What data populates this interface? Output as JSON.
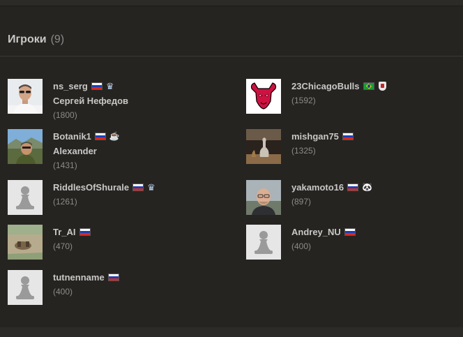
{
  "section": {
    "title": "Игроки",
    "count": "(9)"
  },
  "players": [
    {
      "username": "ns_serg",
      "flag": "ru",
      "badge": "crown",
      "realname": "Сергей Нефедов",
      "rating": "(1800)",
      "avatar": "photo-man"
    },
    {
      "username": "23ChicagoBulls",
      "flag": "br",
      "badge": "shield",
      "realname": "",
      "rating": "(1592)",
      "avatar": "bulls-logo"
    },
    {
      "username": "Botanik1",
      "flag": "ru",
      "badge": "coffee",
      "realname": "Alexander",
      "rating": "(1431)",
      "avatar": "photo-outdoor"
    },
    {
      "username": "mishgan75",
      "flag": "ru",
      "badge": "",
      "realname": "",
      "rating": "(1325)",
      "avatar": "photo-chess"
    },
    {
      "username": "RiddlesOfShurale",
      "flag": "ru",
      "badge": "crown",
      "realname": "",
      "rating": "(1261)",
      "avatar": "pawn"
    },
    {
      "username": "yakamoto16",
      "flag": "ru",
      "badge": "panda",
      "realname": "",
      "rating": "(897)",
      "avatar": "photo-bald"
    },
    {
      "username": "Tr_AI",
      "flag": "ru",
      "badge": "",
      "realname": "",
      "rating": "(470)",
      "avatar": "photo-field"
    },
    {
      "username": "Andrey_NU",
      "flag": "ru",
      "badge": "",
      "realname": "",
      "rating": "(400)",
      "avatar": "pawn"
    },
    {
      "username": "tutnenname",
      "flag": "ru",
      "badge": "",
      "realname": "",
      "rating": "(400)",
      "avatar": "pawn"
    }
  ]
}
